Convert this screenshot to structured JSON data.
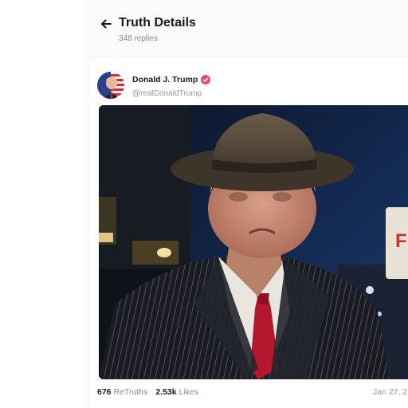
{
  "header": {
    "title": "Truth Details",
    "replies_count": "348 replies"
  },
  "post": {
    "author_name": "Donald J. Trump",
    "author_handle": "@realDonaldTrump",
    "sign_letter": "F",
    "retruths_count": "676",
    "retruths_label": "ReTruths",
    "likes_count": "2.53k",
    "likes_label": "Likes",
    "date": "Jan 27, 2"
  },
  "colors": {
    "verified_badge": "#e0457b",
    "night_sky": "#0f1a2e",
    "tie": "#b3182f"
  },
  "icons": {
    "back": "arrow-left-icon",
    "verified": "verified-badge-icon"
  }
}
